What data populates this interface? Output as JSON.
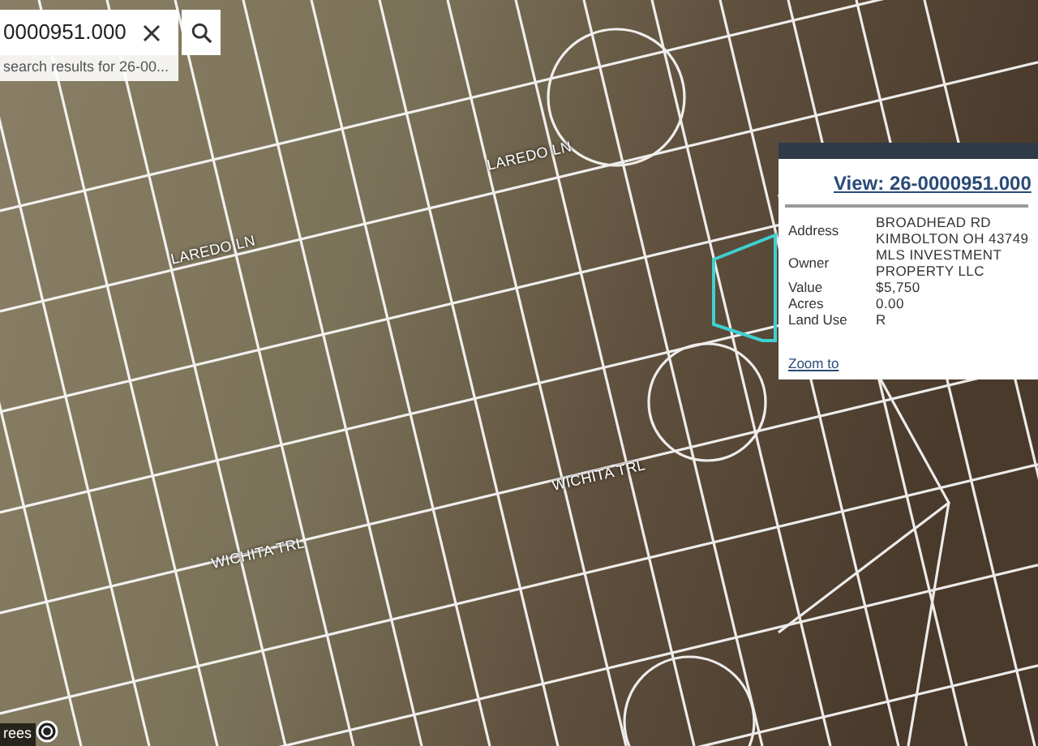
{
  "search": {
    "value": "0000951.000",
    "results_hint": "search results for 26-00..."
  },
  "map": {
    "street_labels": [
      "LAREDO LN",
      "LAREDO LN",
      "WICHITA TRL",
      "WICHITA TRL"
    ],
    "attribution": "rees"
  },
  "popup": {
    "title": "View: 26-0000951.000",
    "fields": [
      {
        "label": "Address",
        "lines": [
          "BROADHEAD RD",
          "KIMBOLTON OH 43749"
        ]
      },
      {
        "label": "Owner",
        "lines": [
          "MLS INVESTMENT",
          "PROPERTY LLC"
        ]
      },
      {
        "label": "Value",
        "lines": [
          "$5,750"
        ]
      },
      {
        "label": "Acres",
        "lines": [
          "0.00"
        ]
      },
      {
        "label": "Land Use",
        "lines": [
          "R"
        ]
      }
    ],
    "zoom_link": "Zoom to"
  }
}
